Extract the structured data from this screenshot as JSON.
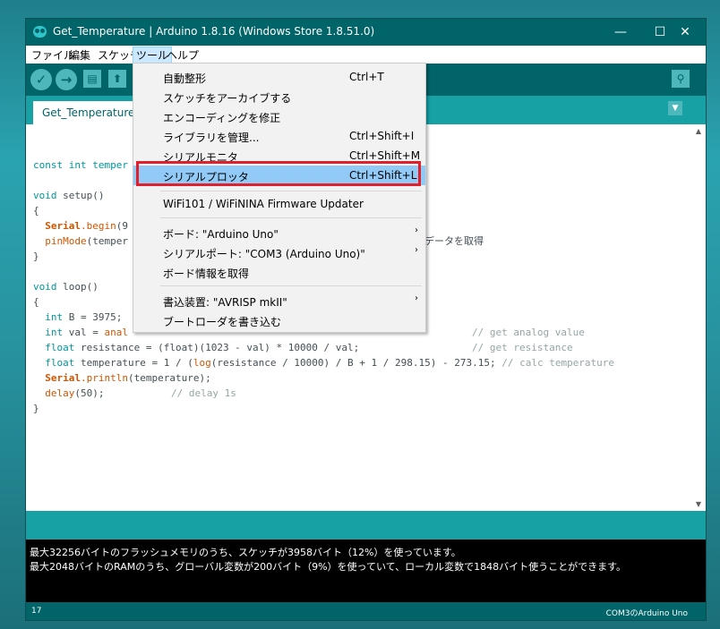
{
  "window": {
    "title": "Get_Temperature | Arduino 1.8.16 (Windows Store 1.8.51.0)",
    "controls": {
      "minimize": "—",
      "maximize": "☐",
      "close": "✕"
    }
  },
  "menubar": [
    "ファイル",
    "編集",
    "スケッチ",
    "ツール",
    "ヘルプ"
  ],
  "toolbar": {
    "verify": "✓",
    "upload": "→",
    "new": "▤",
    "open": "⬆",
    "save": "⬇",
    "serial_monitor": "⚲"
  },
  "tab": {
    "name": "Get_Temperature",
    "menu": "▼"
  },
  "tools_menu": {
    "items": [
      {
        "label": "自動整形",
        "shortcut": "Ctrl+T"
      },
      {
        "label": "スケッチをアーカイブする",
        "shortcut": ""
      },
      {
        "label": "エンコーディングを修正",
        "shortcut": ""
      },
      {
        "label": "ライブラリを管理...",
        "shortcut": "Ctrl+Shift+I"
      },
      {
        "label": "シリアルモニタ",
        "shortcut": "Ctrl+Shift+M"
      },
      {
        "label": "シリアルプロッタ",
        "shortcut": "Ctrl+Shift+L"
      },
      {
        "label": "WiFi101 / WiFiNINA Firmware Updater",
        "shortcut": ""
      },
      {
        "label": "ボード: \"Arduino Uno\"",
        "shortcut": "",
        "submenu": "›"
      },
      {
        "label": "シリアルポート: \"COM3 (Arduino Uno)\"",
        "shortcut": "",
        "submenu": "›"
      },
      {
        "label": "ボード情報を取得",
        "shortcut": ""
      },
      {
        "label": "書込装置: \"AVRISP mkII\"",
        "shortcut": "",
        "submenu": "›"
      },
      {
        "label": "ブートローダを書き込む",
        "shortcut": ""
      }
    ]
  },
  "code": {
    "l1": "const int temper",
    "l3_kw": "void",
    "l3_rest": " setup()",
    "l4": "{",
    "l5_obj": "Serial",
    "l5_fn": ".begin",
    "l5_rest": "(9",
    "l6_fn": "pinMode",
    "l6_rest": "(temper",
    "l6_tail": "データを取得",
    "l7": "}",
    "l9_kw": "void",
    "l9_rest": " loop()",
    "l10": "{",
    "l11_kw": "int",
    "l11_rest": " B = 3975;",
    "l12_kw": "int",
    "l12_rest": " val = ",
    "l12_fn": "anal",
    "l12_cm": "// get analog value",
    "l13_kw": "float",
    "l13_rest": " resistance = (float)(1023 - val) * 10000 / val;",
    "l13_cm": "// get resistance",
    "l14_kw": "float",
    "l14_a": " temperature = 1 / (",
    "l14_fn": "log",
    "l14_b": "(resistance / 10000) / B + 1 / 298.15) - 273.15; ",
    "l14_cm": "// calc temperature",
    "l15_obj": "Serial",
    "l15_fn": ".println",
    "l15_rest": "(temperature);",
    "l16_fn": "delay",
    "l16_rest": "(50);",
    "l16_cm": "// delay 1s",
    "l17": "}"
  },
  "console": {
    "line1": "最大32256バイトのフラッシュメモリのうち、スケッチが3958バイト（12%）を使っています。",
    "line2": "最大2048バイトのRAMのうち、グローバル変数が200バイト（9%）を使っていて、ローカル変数で1848バイト使うことができます。"
  },
  "status": {
    "line_number": "17",
    "board_port": "COM3のArduino Uno"
  }
}
